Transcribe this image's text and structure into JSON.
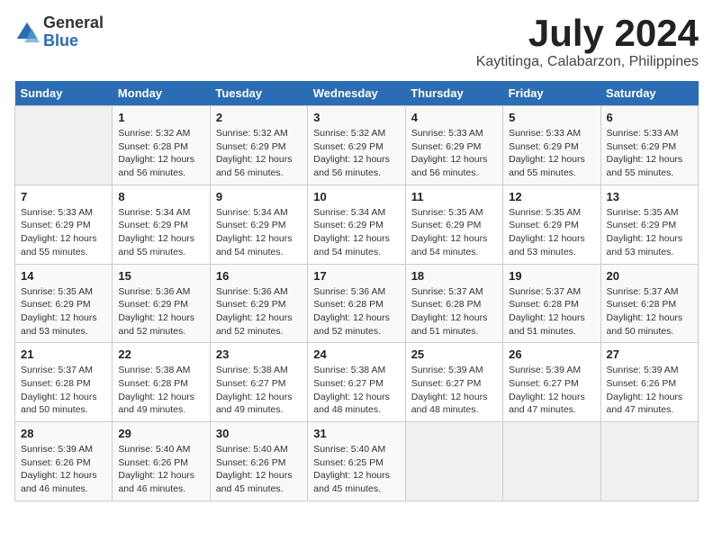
{
  "logo": {
    "general": "General",
    "blue": "Blue"
  },
  "title": "July 2024",
  "subtitle": "Kaytitinga, Calabarzon, Philippines",
  "calendar": {
    "headers": [
      "Sunday",
      "Monday",
      "Tuesday",
      "Wednesday",
      "Thursday",
      "Friday",
      "Saturday"
    ],
    "weeks": [
      [
        {
          "day": "",
          "info": ""
        },
        {
          "day": "1",
          "info": "Sunrise: 5:32 AM\nSunset: 6:28 PM\nDaylight: 12 hours\nand 56 minutes."
        },
        {
          "day": "2",
          "info": "Sunrise: 5:32 AM\nSunset: 6:29 PM\nDaylight: 12 hours\nand 56 minutes."
        },
        {
          "day": "3",
          "info": "Sunrise: 5:32 AM\nSunset: 6:29 PM\nDaylight: 12 hours\nand 56 minutes."
        },
        {
          "day": "4",
          "info": "Sunrise: 5:33 AM\nSunset: 6:29 PM\nDaylight: 12 hours\nand 56 minutes."
        },
        {
          "day": "5",
          "info": "Sunrise: 5:33 AM\nSunset: 6:29 PM\nDaylight: 12 hours\nand 55 minutes."
        },
        {
          "day": "6",
          "info": "Sunrise: 5:33 AM\nSunset: 6:29 PM\nDaylight: 12 hours\nand 55 minutes."
        }
      ],
      [
        {
          "day": "7",
          "info": "Sunrise: 5:33 AM\nSunset: 6:29 PM\nDaylight: 12 hours\nand 55 minutes."
        },
        {
          "day": "8",
          "info": "Sunrise: 5:34 AM\nSunset: 6:29 PM\nDaylight: 12 hours\nand 55 minutes."
        },
        {
          "day": "9",
          "info": "Sunrise: 5:34 AM\nSunset: 6:29 PM\nDaylight: 12 hours\nand 54 minutes."
        },
        {
          "day": "10",
          "info": "Sunrise: 5:34 AM\nSunset: 6:29 PM\nDaylight: 12 hours\nand 54 minutes."
        },
        {
          "day": "11",
          "info": "Sunrise: 5:35 AM\nSunset: 6:29 PM\nDaylight: 12 hours\nand 54 minutes."
        },
        {
          "day": "12",
          "info": "Sunrise: 5:35 AM\nSunset: 6:29 PM\nDaylight: 12 hours\nand 53 minutes."
        },
        {
          "day": "13",
          "info": "Sunrise: 5:35 AM\nSunset: 6:29 PM\nDaylight: 12 hours\nand 53 minutes."
        }
      ],
      [
        {
          "day": "14",
          "info": "Sunrise: 5:35 AM\nSunset: 6:29 PM\nDaylight: 12 hours\nand 53 minutes."
        },
        {
          "day": "15",
          "info": "Sunrise: 5:36 AM\nSunset: 6:29 PM\nDaylight: 12 hours\nand 52 minutes."
        },
        {
          "day": "16",
          "info": "Sunrise: 5:36 AM\nSunset: 6:29 PM\nDaylight: 12 hours\nand 52 minutes."
        },
        {
          "day": "17",
          "info": "Sunrise: 5:36 AM\nSunset: 6:28 PM\nDaylight: 12 hours\nand 52 minutes."
        },
        {
          "day": "18",
          "info": "Sunrise: 5:37 AM\nSunset: 6:28 PM\nDaylight: 12 hours\nand 51 minutes."
        },
        {
          "day": "19",
          "info": "Sunrise: 5:37 AM\nSunset: 6:28 PM\nDaylight: 12 hours\nand 51 minutes."
        },
        {
          "day": "20",
          "info": "Sunrise: 5:37 AM\nSunset: 6:28 PM\nDaylight: 12 hours\nand 50 minutes."
        }
      ],
      [
        {
          "day": "21",
          "info": "Sunrise: 5:37 AM\nSunset: 6:28 PM\nDaylight: 12 hours\nand 50 minutes."
        },
        {
          "day": "22",
          "info": "Sunrise: 5:38 AM\nSunset: 6:28 PM\nDaylight: 12 hours\nand 49 minutes."
        },
        {
          "day": "23",
          "info": "Sunrise: 5:38 AM\nSunset: 6:27 PM\nDaylight: 12 hours\nand 49 minutes."
        },
        {
          "day": "24",
          "info": "Sunrise: 5:38 AM\nSunset: 6:27 PM\nDaylight: 12 hours\nand 48 minutes."
        },
        {
          "day": "25",
          "info": "Sunrise: 5:39 AM\nSunset: 6:27 PM\nDaylight: 12 hours\nand 48 minutes."
        },
        {
          "day": "26",
          "info": "Sunrise: 5:39 AM\nSunset: 6:27 PM\nDaylight: 12 hours\nand 47 minutes."
        },
        {
          "day": "27",
          "info": "Sunrise: 5:39 AM\nSunset: 6:26 PM\nDaylight: 12 hours\nand 47 minutes."
        }
      ],
      [
        {
          "day": "28",
          "info": "Sunrise: 5:39 AM\nSunset: 6:26 PM\nDaylight: 12 hours\nand 46 minutes."
        },
        {
          "day": "29",
          "info": "Sunrise: 5:40 AM\nSunset: 6:26 PM\nDaylight: 12 hours\nand 46 minutes."
        },
        {
          "day": "30",
          "info": "Sunrise: 5:40 AM\nSunset: 6:26 PM\nDaylight: 12 hours\nand 45 minutes."
        },
        {
          "day": "31",
          "info": "Sunrise: 5:40 AM\nSunset: 6:25 PM\nDaylight: 12 hours\nand 45 minutes."
        },
        {
          "day": "",
          "info": ""
        },
        {
          "day": "",
          "info": ""
        },
        {
          "day": "",
          "info": ""
        }
      ]
    ]
  }
}
